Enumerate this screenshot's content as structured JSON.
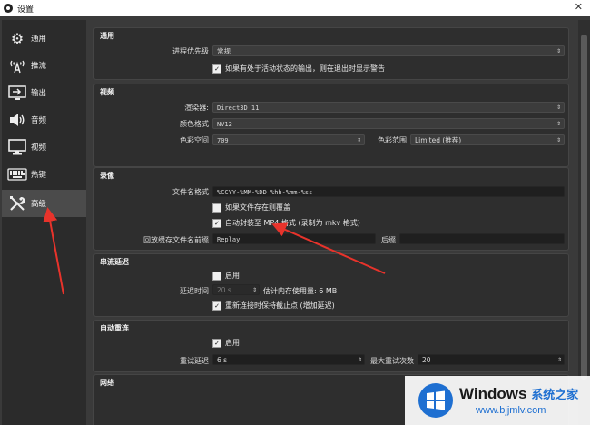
{
  "window": {
    "title": "设置",
    "close_glyph": "✕"
  },
  "sidebar": {
    "items": [
      {
        "label": "通用",
        "icon": "gear-icon"
      },
      {
        "label": "推流",
        "icon": "antenna-icon"
      },
      {
        "label": "输出",
        "icon": "output-icon"
      },
      {
        "label": "音频",
        "icon": "speaker-icon"
      },
      {
        "label": "视频",
        "icon": "monitor-icon"
      },
      {
        "label": "热键",
        "icon": "keyboard-icon"
      },
      {
        "label": "高级",
        "icon": "tools-icon",
        "active": true
      }
    ]
  },
  "general": {
    "title": "通用",
    "priority_label": "进程优先级",
    "priority_value": "常规",
    "warn_checkbox": "如果有处于活动状态的输出，则在退出时显示警告",
    "warn_checked": true
  },
  "video": {
    "title": "视频",
    "renderer_label": "渲染器:",
    "renderer_value": "Direct3D 11",
    "color_format_label": "颜色格式",
    "color_format_value": "NV12",
    "color_space_label": "色彩空间",
    "color_space_value": "709",
    "color_range_label": "色彩范围",
    "color_range_value": "Limited (推荐)"
  },
  "recording": {
    "title": "录像",
    "filename_label": "文件名格式",
    "filename_value": "%CCYY-%MM-%DD %hh-%mm-%ss",
    "overwrite_checkbox": "如果文件存在则覆盖",
    "overwrite_checked": false,
    "autoremux_checkbox": "自动封装至 MP4 格式 (录制为 mkv 格式)",
    "autoremux_checked": true,
    "replay_prefix_label": "回放缓存文件名前缀",
    "replay_prefix_value": "Replay",
    "suffix_label": "后缀"
  },
  "stream_delay": {
    "title": "串流延迟",
    "enable_checkbox": "启用",
    "enable_checked": false,
    "delay_label": "延迟时间",
    "delay_value": "20 s",
    "memory_text": "估计内存使用量: 6 MB",
    "preserve_checkbox": "重新连接时保持截止点 (增加延迟)",
    "preserve_checked": true
  },
  "auto_reconnect": {
    "title": "自动重连",
    "enable_checkbox": "启用",
    "enable_checked": true,
    "retry_delay_label": "重试延迟",
    "retry_delay_value": "6 s",
    "max_retries_label": "最大重试次数",
    "max_retries_value": "20"
  },
  "network": {
    "title": "网络"
  },
  "watermark": {
    "brand": "Windows",
    "brand_cn": "系统之家",
    "url": "www.bjjmlv.com"
  },
  "annotation_color": "#e8332b"
}
